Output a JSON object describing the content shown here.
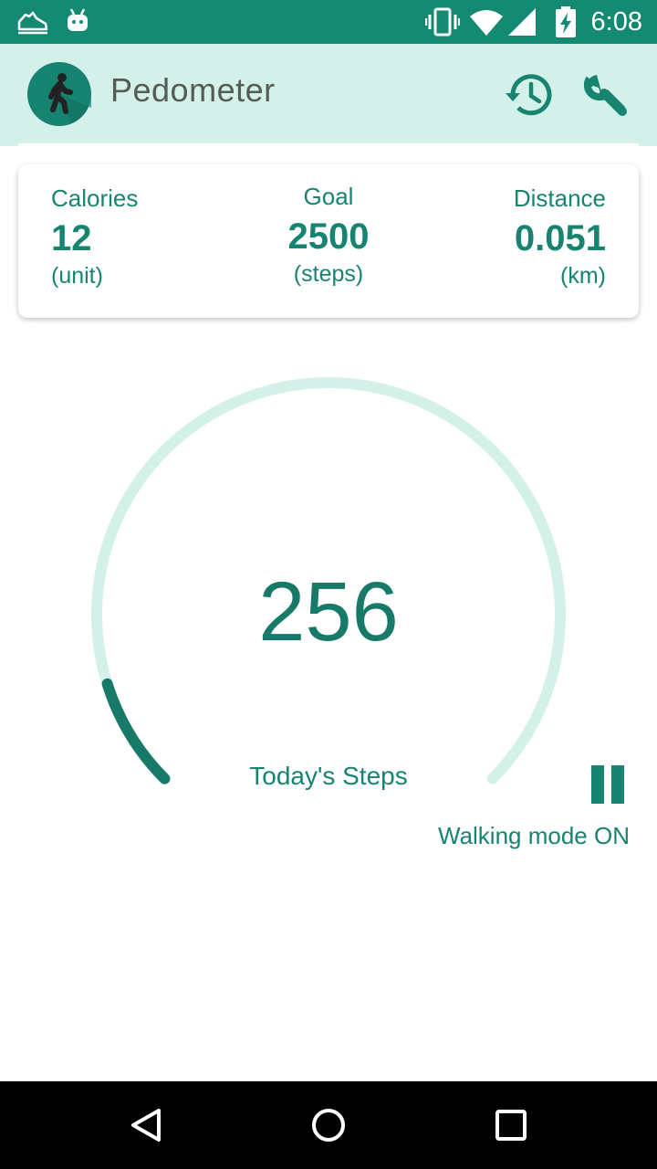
{
  "status_bar": {
    "time": "6:08",
    "icons": [
      "shoe-notification-icon",
      "android-notification-icon",
      "vibrate-icon",
      "wifi-icon",
      "signal-icon",
      "battery-charging-icon"
    ]
  },
  "app_bar": {
    "title": "Pedometer",
    "icons": [
      "walking-person-icon",
      "history-icon",
      "wrench-icon"
    ]
  },
  "stats": {
    "calories": {
      "label": "Calories",
      "value": "12",
      "unit": "(unit)"
    },
    "goal": {
      "label": "Goal",
      "value": "2500",
      "unit": "(steps)"
    },
    "distance": {
      "label": "Distance",
      "value": "0.051",
      "unit": "(km)"
    }
  },
  "progress": {
    "steps": "256",
    "label": "Today's Steps",
    "fraction": 0.1024
  },
  "walking_mode": {
    "text": "Walking mode ON",
    "control": "pause-icon"
  },
  "nav_bar": {
    "icons": [
      "back-icon",
      "home-icon",
      "recents-icon"
    ]
  },
  "colors": {
    "status_bar": "#148a72",
    "app_bar": "#d3f1e9",
    "accent": "#178371",
    "track": "#d3f1e9",
    "progress": "#177a68",
    "nav_bar": "#000000"
  }
}
